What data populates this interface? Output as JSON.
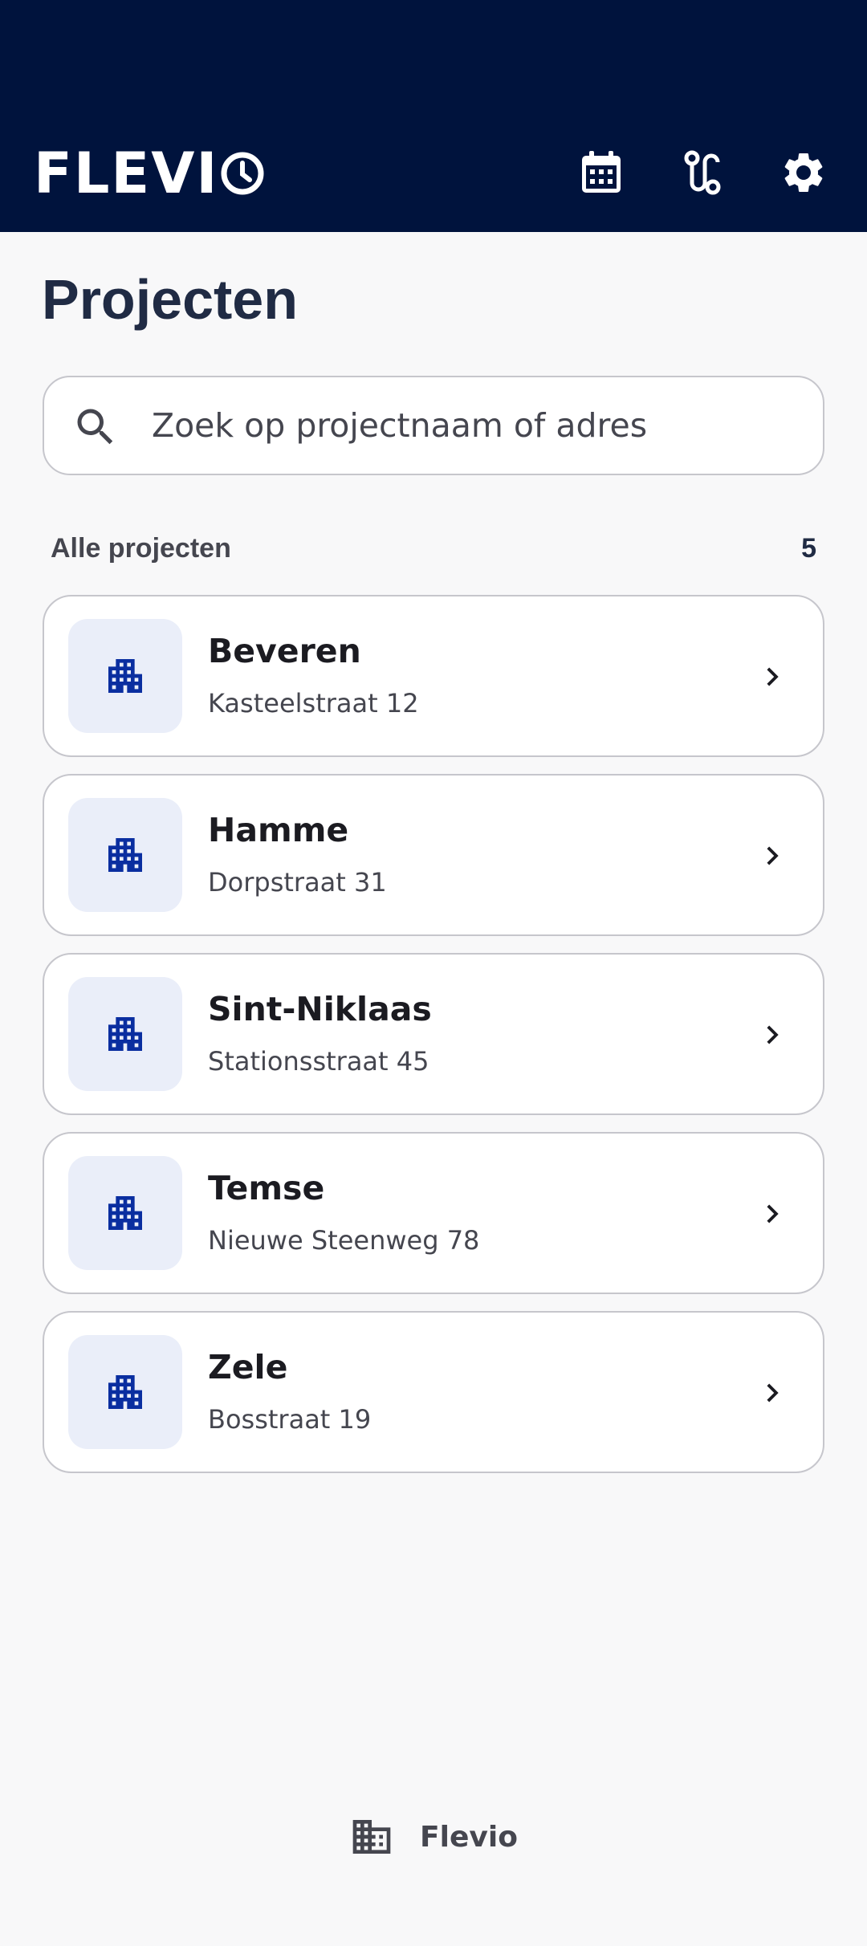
{
  "app": {
    "logo_text": "FLEVI",
    "colors": {
      "header_bg": "#00133d",
      "accent": "#0a2ea0",
      "icon_box": "#eaeef9",
      "title": "#202b44"
    }
  },
  "header": {
    "icons": [
      "calendar-icon",
      "route-icon",
      "settings-icon"
    ]
  },
  "page": {
    "title": "Projecten"
  },
  "search": {
    "placeholder": "Zoek op projectnaam of adres",
    "value": ""
  },
  "section": {
    "label": "Alle projecten",
    "count": "5"
  },
  "projects": [
    {
      "name": "Beveren",
      "address": "Kasteelstraat 12"
    },
    {
      "name": "Hamme",
      "address": "Dorpstraat 31"
    },
    {
      "name": "Sint-Niklaas",
      "address": "Stationsstraat 45"
    },
    {
      "name": "Temse",
      "address": "Nieuwe Steenweg 78"
    },
    {
      "name": "Zele",
      "address": "Bosstraat 19"
    }
  ],
  "footer": {
    "label": "Flevio",
    "icon": "building-icon"
  }
}
